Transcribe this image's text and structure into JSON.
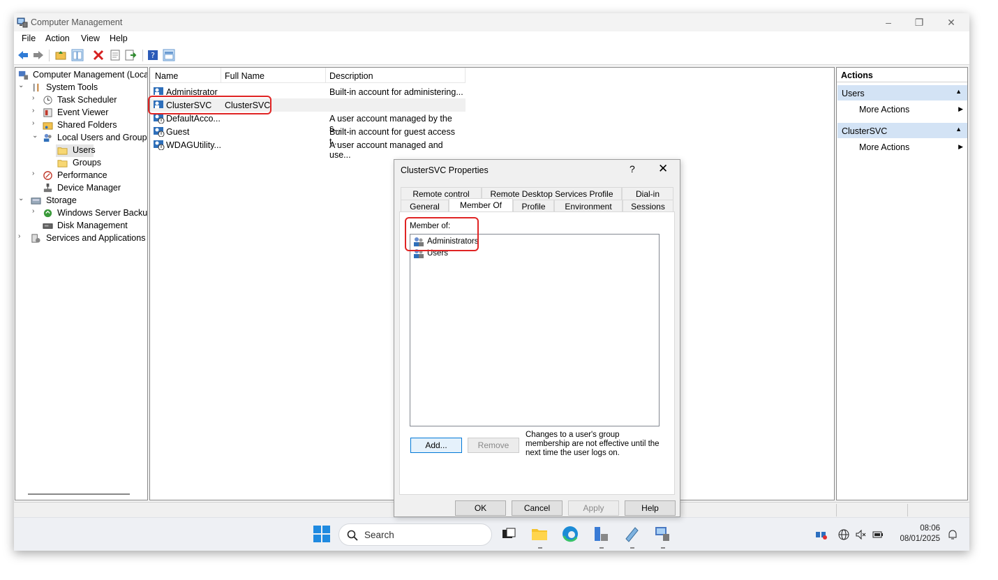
{
  "window": {
    "title": "Computer Management",
    "controls": {
      "minimize": "–",
      "restore": "❐",
      "close": "✕"
    }
  },
  "menu": [
    "File",
    "Action",
    "View",
    "Help"
  ],
  "tree": {
    "root": "Computer Management (Local",
    "system_tools": "System Tools",
    "task_scheduler": "Task Scheduler",
    "event_viewer": "Event Viewer",
    "shared_folders": "Shared Folders",
    "local_users_groups": "Local Users and Groups",
    "users": "Users",
    "groups": "Groups",
    "performance": "Performance",
    "device_manager": "Device Manager",
    "storage": "Storage",
    "windows_server_backup": "Windows Server Backup",
    "disk_management": "Disk Management",
    "services_apps": "Services and Applications"
  },
  "list": {
    "columns": [
      "Name",
      "Full Name",
      "Description"
    ],
    "rows": [
      {
        "name": "Administrator",
        "full_name": "",
        "description": "Built-in account for administering..."
      },
      {
        "name": "ClusterSVC",
        "full_name": "ClusterSVC",
        "description": ""
      },
      {
        "name": "DefaultAcco...",
        "full_name": "",
        "description": "A user account managed by the s..."
      },
      {
        "name": "Guest",
        "full_name": "",
        "description": "Built-in account for guest access t..."
      },
      {
        "name": "WDAGUtility...",
        "full_name": "",
        "description": "A user account managed and use..."
      }
    ]
  },
  "actions": {
    "header": "Actions",
    "section1": "Users",
    "section1_item": "More Actions",
    "section2": "ClusterSVC",
    "section2_item": "More Actions"
  },
  "dialog": {
    "title": "ClusterSVC Properties",
    "help": "?",
    "close": "✕",
    "tabs_row1": [
      "Remote control",
      "Remote Desktop Services Profile",
      "Dial-in"
    ],
    "tabs_row2": [
      "General",
      "Member Of",
      "Profile",
      "Environment",
      "Sessions"
    ],
    "active_tab": "Member Of",
    "member_of_label": "Member of:",
    "members": [
      "Administrators",
      "Users"
    ],
    "add_button": "Add...",
    "remove_button": "Remove",
    "note": "Changes to a user's group membership are not effective until the next time the user logs on.",
    "ok": "OK",
    "cancel": "Cancel",
    "apply": "Apply",
    "help_button": "Help"
  },
  "taskbar": {
    "search_placeholder": "Search",
    "time": "08:06",
    "date": "08/01/2025"
  },
  "colors": {
    "highlight_red": "#e02424",
    "selection_blue": "#d3e3f5",
    "accent": "#0078d7"
  }
}
